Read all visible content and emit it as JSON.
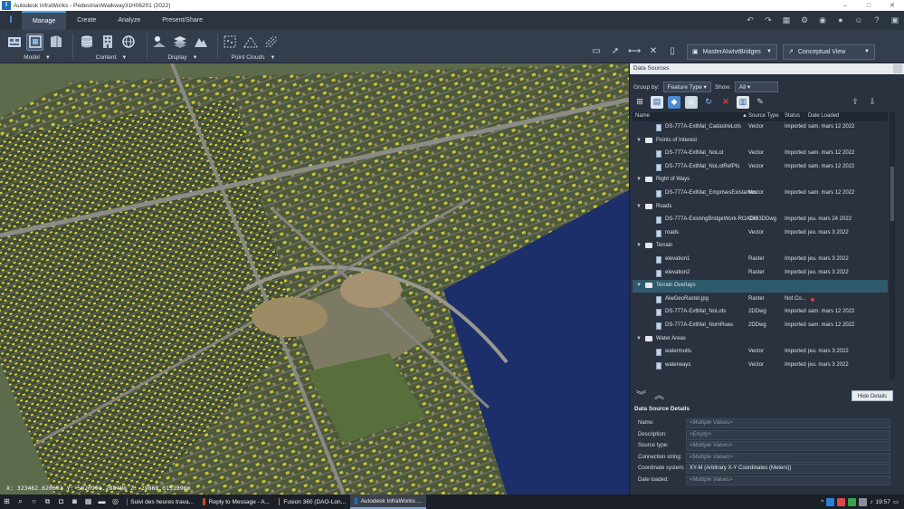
{
  "window": {
    "title": "Autodesk InfraWorks - PedestrianWalkway31H06201 (2022)",
    "controls": [
      "–",
      "□",
      "✕"
    ]
  },
  "ribbon": {
    "tabs": [
      {
        "label": "Manage",
        "active": true
      },
      {
        "label": "Create",
        "active": false
      },
      {
        "label": "Analyze",
        "active": false
      },
      {
        "label": "Present/Share",
        "active": false
      }
    ],
    "groups": [
      {
        "label": "Model"
      },
      {
        "label": "Content"
      },
      {
        "label": "Display"
      },
      {
        "label": "Point Clouds"
      }
    ]
  },
  "view_toolbar": {
    "proposal": "MasterAIwIvtBridges",
    "visual_style": "Conceptual View"
  },
  "viewport": {
    "coordinates": "X: 323462.620693 Y: 5020998.288498 Z: 29868.015139mm"
  },
  "data_sources": {
    "title": "Data Sources",
    "group_by_label": "Group by:",
    "group_by_value": "Feature Type",
    "show_label": "Show:",
    "show_value": "All",
    "columns": {
      "name": "Name",
      "source_type": "Source Type",
      "status": "Status",
      "date_loaded": "Date Loaded"
    },
    "rows": [
      {
        "kind": "item",
        "name": "DS-777A-ExtMat_CadastreLots",
        "source_type": "Vector",
        "status": "Imported",
        "date": "sam. mars 12 2022"
      },
      {
        "kind": "folder",
        "name": "Points of Interest"
      },
      {
        "kind": "item",
        "name": "DS-777A-ExtMat_NoLot",
        "source_type": "Vector",
        "status": "Imported",
        "date": "sam. mars 12 2022"
      },
      {
        "kind": "item",
        "name": "DS-777A-ExtMat_NoLotRefPts",
        "source_type": "Vector",
        "status": "Imported",
        "date": "sam. mars 12 2022"
      },
      {
        "kind": "folder",
        "name": "Right of Ways"
      },
      {
        "kind": "item",
        "name": "DS-777A-ExtMat_EmprisesExistantes",
        "source_type": "Vector",
        "status": "Imported",
        "date": "sam. mars 12 2022"
      },
      {
        "kind": "folder",
        "name": "Roads"
      },
      {
        "kind": "item",
        "name": "DS-777A-ExistingBridgeWork-ROADS",
        "source_type": "Civil3DDwg",
        "status": "Imported",
        "date": "jeu. mars 24 2022"
      },
      {
        "kind": "item",
        "name": "roads",
        "source_type": "Vector",
        "status": "Imported",
        "date": "jeu. mars 3 2022"
      },
      {
        "kind": "folder",
        "name": "Terrain"
      },
      {
        "kind": "item",
        "name": "elevation1",
        "source_type": "Raster",
        "status": "Imported",
        "date": "jeu. mars 3 2022"
      },
      {
        "kind": "item",
        "name": "elevation2",
        "source_type": "Raster",
        "status": "Imported",
        "date": "jeu. mars 3 2022"
      },
      {
        "kind": "folder",
        "name": "Terrain Overlays",
        "highlight": true
      },
      {
        "kind": "item",
        "name": "AiwGeoRaster.jpg",
        "source_type": "Raster",
        "status": "Not Co...",
        "date": "",
        "error": true
      },
      {
        "kind": "item",
        "name": "DS-777A-ExtMat_NoLots",
        "source_type": "2DDwg",
        "status": "Imported",
        "date": "sam. mars 12 2022"
      },
      {
        "kind": "item",
        "name": "DS-777A-ExtMat_NomRues",
        "source_type": "2DDwg",
        "status": "Imported",
        "date": "sam. mars 12 2022"
      },
      {
        "kind": "folder",
        "name": "Water Areas"
      },
      {
        "kind": "item",
        "name": "watermults",
        "source_type": "Vector",
        "status": "Imported",
        "date": "jeu. mars 3 2022"
      },
      {
        "kind": "item",
        "name": "waterways",
        "source_type": "Vector",
        "status": "Imported",
        "date": "jeu. mars 3 2022"
      }
    ],
    "hide_details": "Hide Details",
    "details_title": "Data Source Details",
    "details": [
      {
        "label": "Name:",
        "value": "<Multiple Values>",
        "placeholder": true
      },
      {
        "label": "Description:",
        "value": "<Empty>",
        "placeholder": true
      },
      {
        "label": "Source type:",
        "value": "<Multiple Values>",
        "placeholder": true
      },
      {
        "label": "Connection string:",
        "value": "<Multiple Values>",
        "placeholder": true
      },
      {
        "label": "Coordinate system:",
        "value": "XY-M (Arbitrary X-Y Coordinates (Meters))",
        "placeholder": false
      },
      {
        "label": "Date loaded:",
        "value": "<Multiple Values>",
        "placeholder": true
      }
    ]
  },
  "taskbar": {
    "apps": [
      {
        "label": "Suivi des heures trava...",
        "color": "#5b5fc7",
        "active": false
      },
      {
        "label": "Reply to Message - A...",
        "color": "#d04a2f",
        "active": false
      },
      {
        "label": "Fusion 360 (DAO-Lon...",
        "color": "#e8761d",
        "active": false
      },
      {
        "label": "Autodesk InfraWorks ...",
        "color": "#1f6fb5",
        "active": true
      }
    ],
    "time": "19:57"
  }
}
